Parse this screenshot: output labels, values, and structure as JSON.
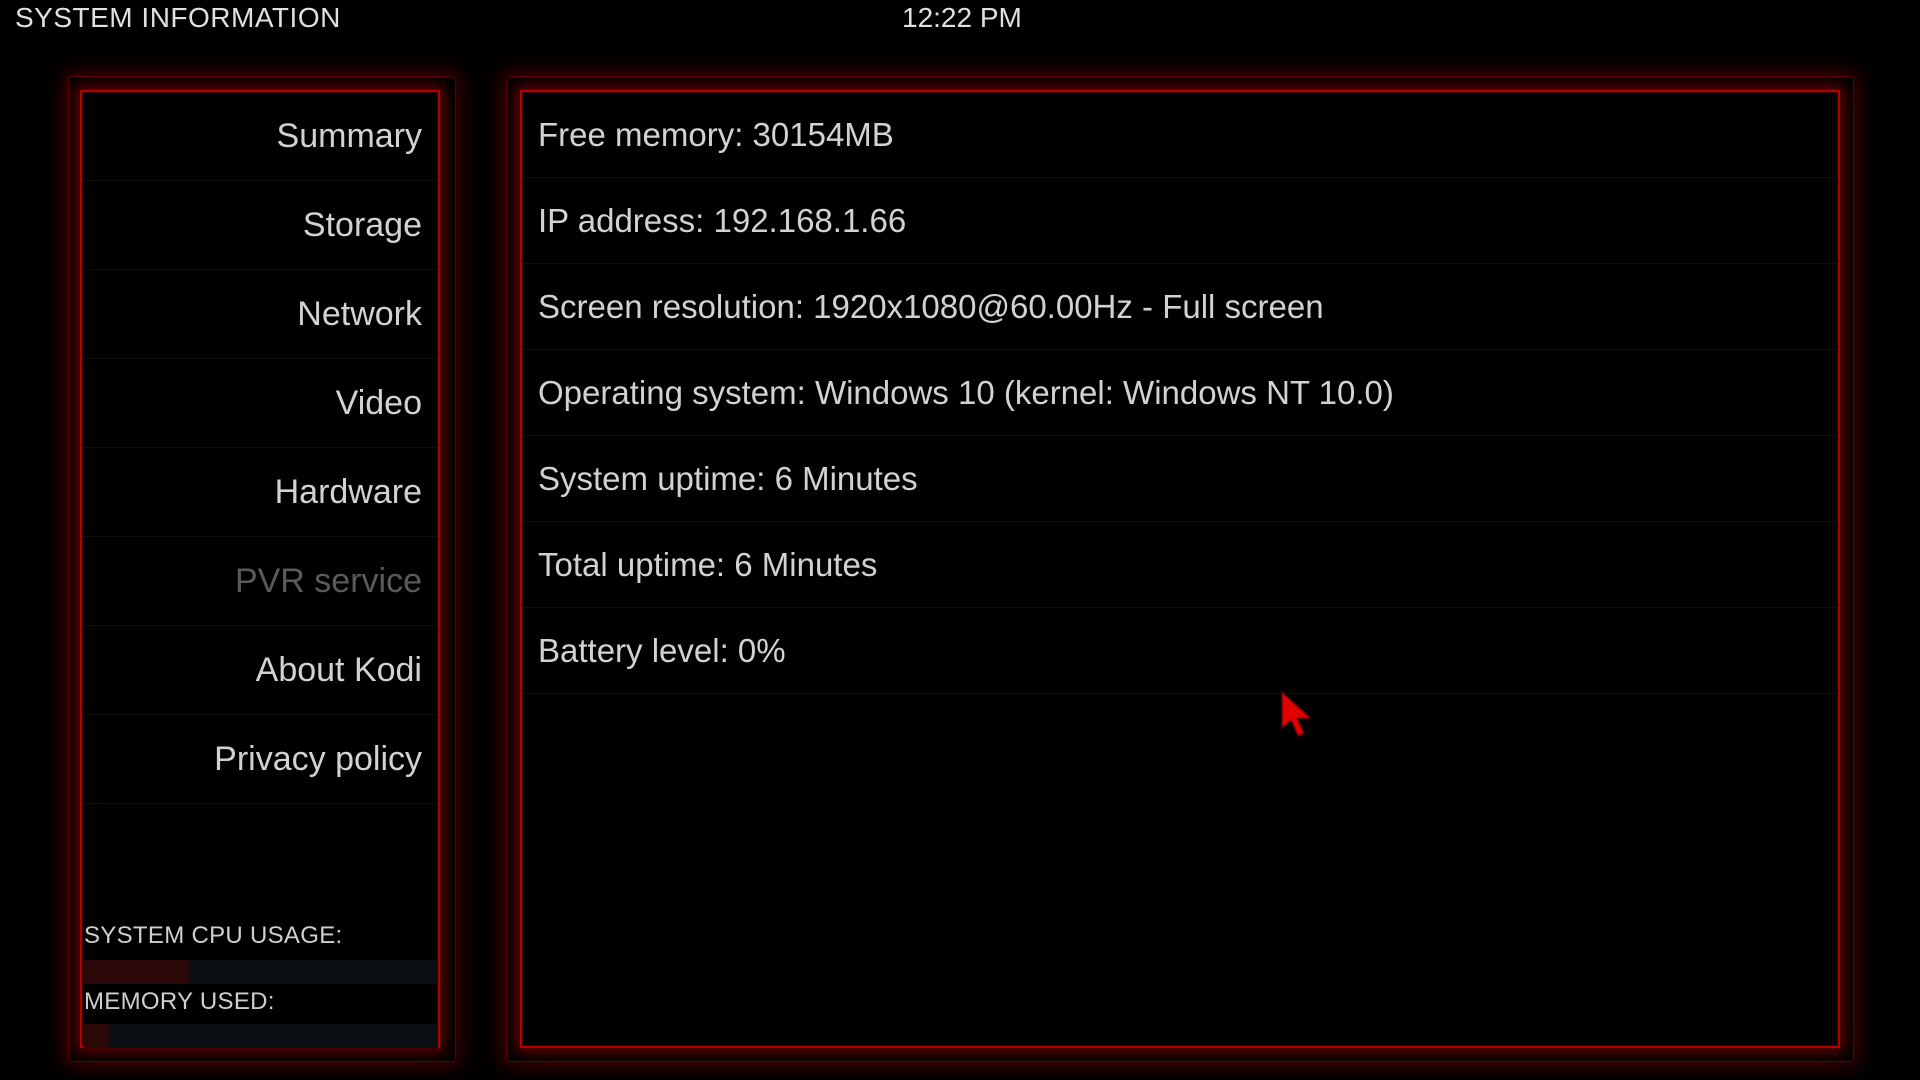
{
  "header": {
    "title": "SYSTEM INFORMATION",
    "clock": "12:22 PM"
  },
  "sidebar": {
    "items": [
      {
        "label": "Summary",
        "enabled": true
      },
      {
        "label": "Storage",
        "enabled": true
      },
      {
        "label": "Network",
        "enabled": true
      },
      {
        "label": "Video",
        "enabled": true
      },
      {
        "label": "Hardware",
        "enabled": true
      },
      {
        "label": "PVR service",
        "enabled": false
      },
      {
        "label": "About Kodi",
        "enabled": true
      },
      {
        "label": "Privacy policy",
        "enabled": true
      }
    ],
    "cpu_label": "SYSTEM CPU USAGE:",
    "cpu_usage_fraction": 0.3,
    "memory_label": "MEMORY USED:",
    "memory_usage_fraction": 0.07
  },
  "info": {
    "rows": [
      "Free memory: 30154MB",
      "IP address: 192.168.1.66",
      "Screen resolution: 1920x1080@60.00Hz - Full screen",
      "Operating system: Windows 10 (kernel: Windows NT 10.0)",
      "System uptime: 6 Minutes",
      "Total uptime: 6 Minutes",
      "Battery level: 0%"
    ]
  },
  "colors": {
    "accent": "#b00000",
    "cursor": "#e00000",
    "background": "#000000"
  },
  "icons": {
    "cursor": "mouse-pointer-icon"
  }
}
